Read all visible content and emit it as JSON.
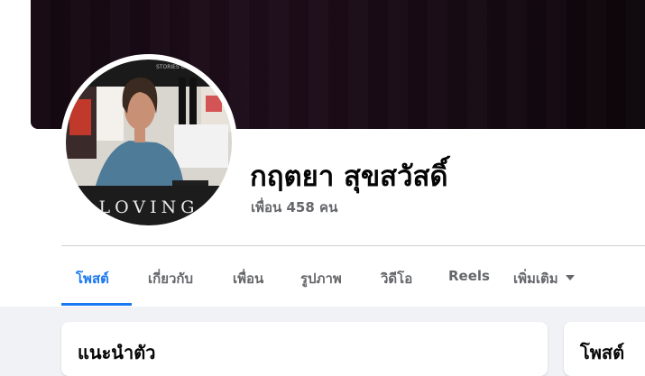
{
  "profile": {
    "name": "กฤตยา สุขสวัสดิ์",
    "friends": "เพื่อน 458 คน",
    "photo_caption_top": "STORIES CHANGE",
    "photo_caption_bottom": "LOVING"
  },
  "tabs": [
    {
      "label": "โพสต์",
      "active": true
    },
    {
      "label": "เกี่ยวกับ"
    },
    {
      "label": "เพื่อน"
    },
    {
      "label": "รูปภาพ"
    },
    {
      "label": "วิดีโอ"
    },
    {
      "label": "Reels"
    },
    {
      "label": "เพิ่มเติม",
      "icon": "caret-down-icon"
    }
  ],
  "cards": {
    "intro_title": "แนะนำตัว",
    "posts_title": "โพสต์"
  },
  "colors": {
    "accent": "#1877f2",
    "page_bg": "#f0f2f5",
    "text_secondary": "#65676b"
  }
}
